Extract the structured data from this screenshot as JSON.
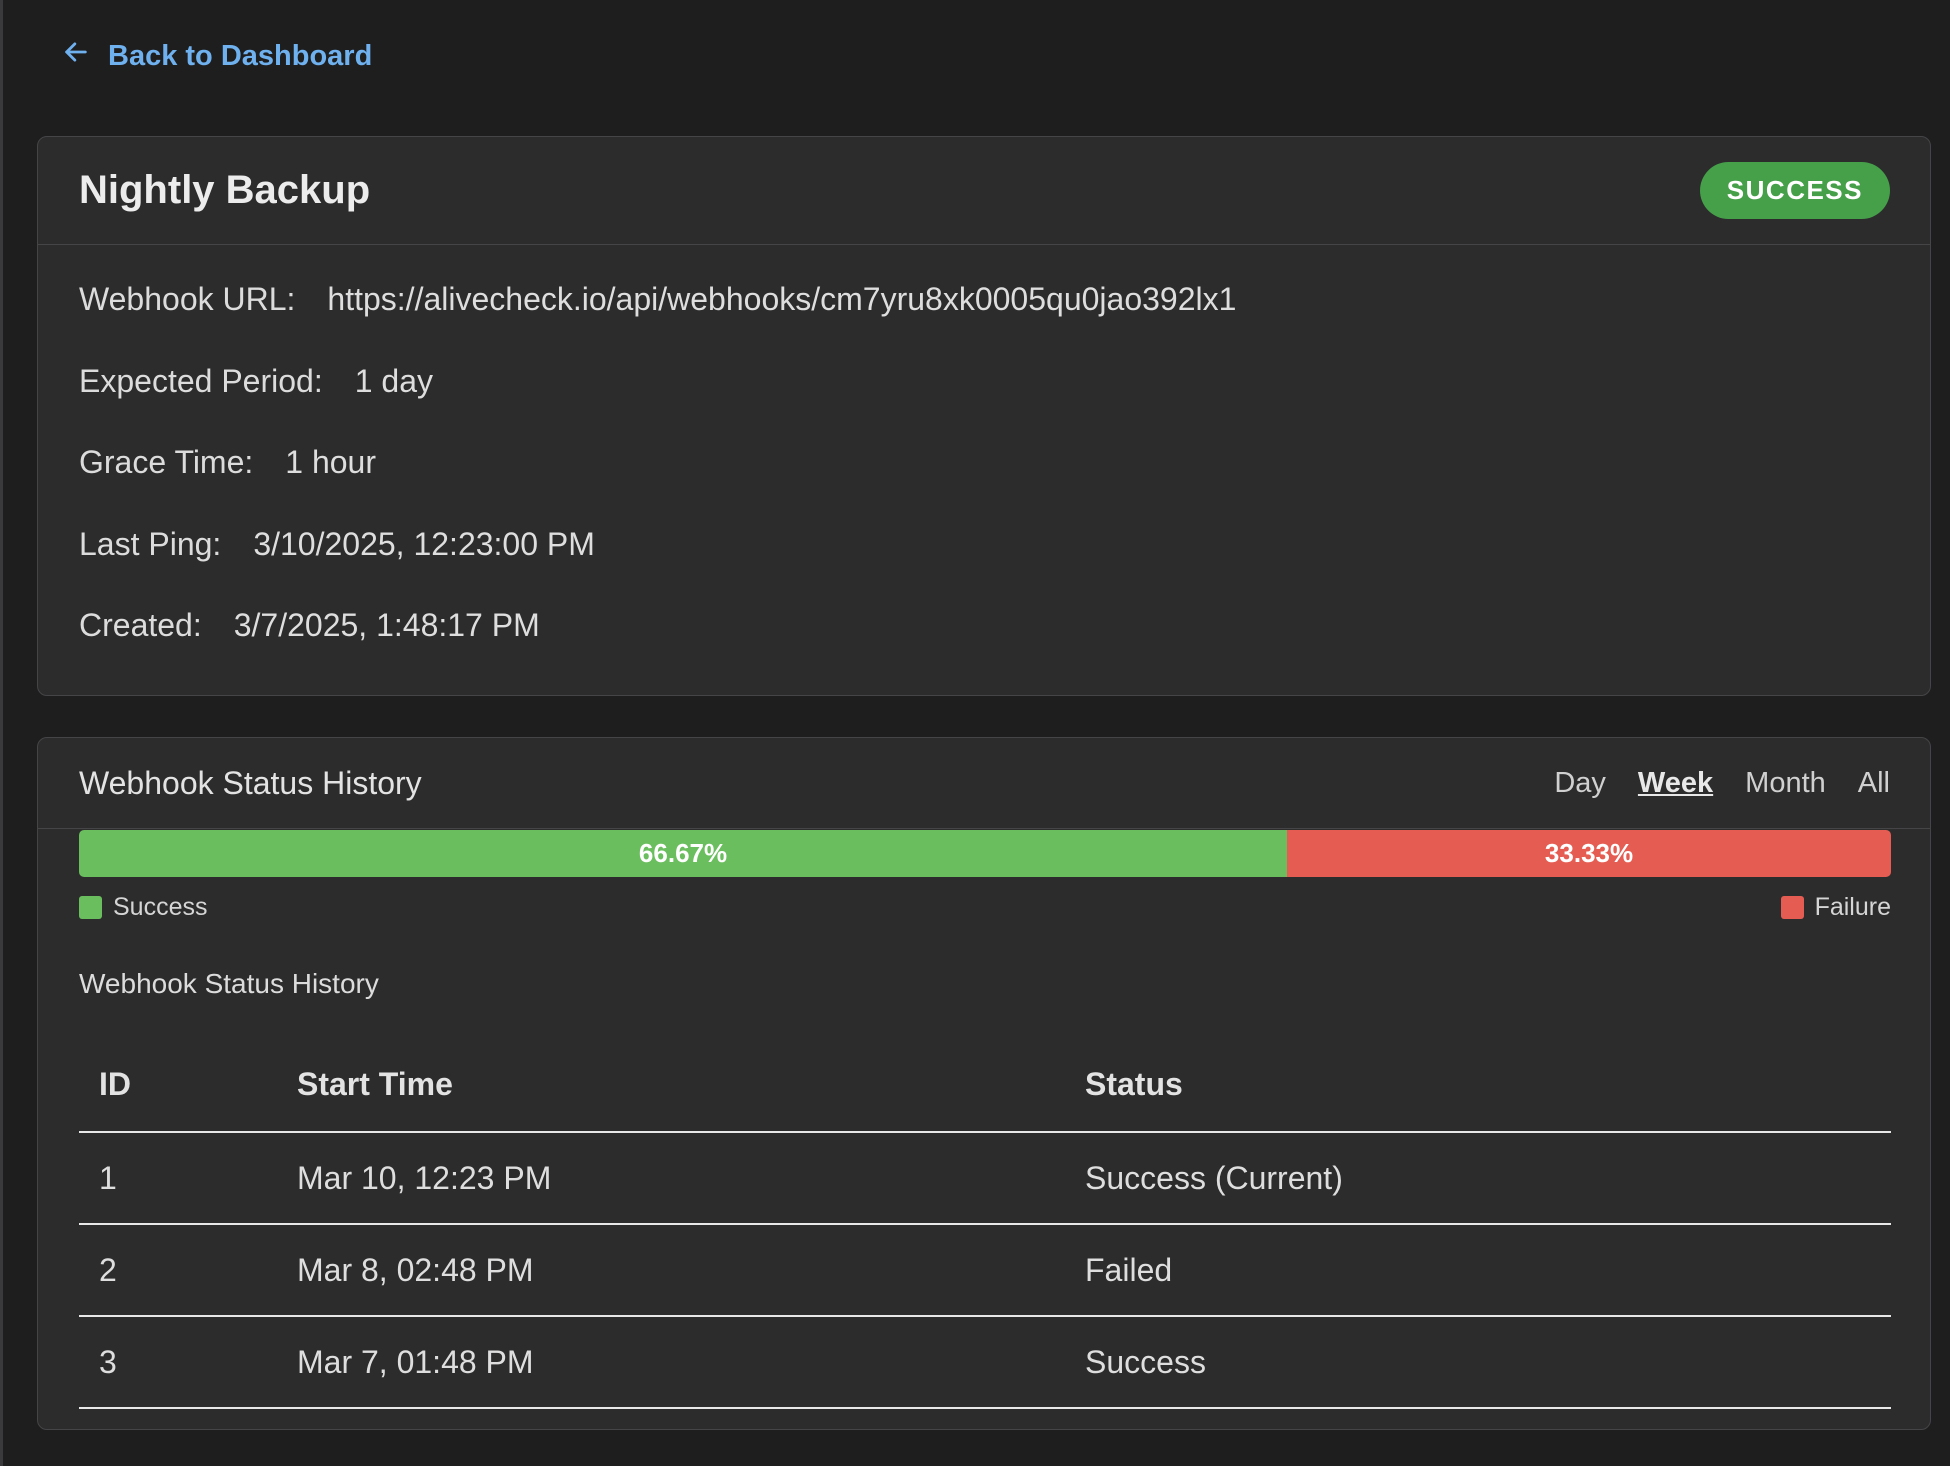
{
  "nav": {
    "back_label": "Back to Dashboard"
  },
  "monitor": {
    "name": "Nightly Backup",
    "status": "SUCCESS",
    "details": [
      {
        "label": "Webhook URL:",
        "value": "https://alivecheck.io/api/webhooks/cm7yru8xk0005qu0jao392lx1"
      },
      {
        "label": "Expected Period:",
        "value": "1 day"
      },
      {
        "label": "Grace Time:",
        "value": "1 hour"
      },
      {
        "label": "Last Ping:",
        "value": "3/10/2025, 12:23:00 PM"
      },
      {
        "label": "Created:",
        "value": "3/7/2025, 1:48:17 PM"
      }
    ]
  },
  "history": {
    "title": "Webhook Status History",
    "range_tabs": [
      "Day",
      "Week",
      "Month",
      "All"
    ],
    "active_range": "Week",
    "ratio": {
      "success_pct": 66.67,
      "success_label": "66.67%",
      "failure_pct": 33.33,
      "failure_label": "33.33%"
    },
    "legend": {
      "success": "Success",
      "failure": "Failure"
    },
    "table_title": "Webhook Status History",
    "columns": [
      "ID",
      "Start Time",
      "Status"
    ],
    "rows": [
      {
        "id": "1",
        "start": "Mar 10, 12:23 PM",
        "status": "Success (Current)",
        "kind": "success"
      },
      {
        "id": "2",
        "start": "Mar 8, 02:48 PM",
        "status": "Failed",
        "kind": "failed"
      },
      {
        "id": "3",
        "start": "Mar 7, 01:48 PM",
        "status": "Success",
        "kind": "success"
      }
    ]
  },
  "colors": {
    "success": "#6abe5e",
    "failure": "#e55d52",
    "badge": "#45a049",
    "link": "#6fb0ee"
  }
}
